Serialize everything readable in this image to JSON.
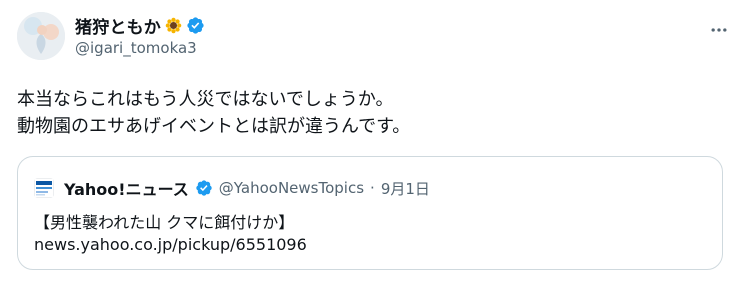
{
  "tweet": {
    "author": {
      "display_name": "猪狩ともか",
      "emoji": "sunflower",
      "verified_icon": "verified-badge-icon",
      "handle": "@igari_tomoka3"
    },
    "text_lines": [
      "本当ならこれはもう人災ではないでしょうか。",
      "動物園のエサあげイベントとは訳が違うんです。"
    ],
    "more_icon": "more-options-icon"
  },
  "quote": {
    "author": {
      "display_name": "Yahoo!ニュース",
      "handle": "@YahooNewsTopics",
      "separator": "·",
      "date": "9月1日",
      "verified_icon": "verified-badge-icon"
    },
    "lines": [
      "【男性襲われた山 クマに餌付けか】",
      "news.yahoo.co.jp/pickup/6551096"
    ]
  },
  "colors": {
    "text": "#0f1419",
    "secondary": "#536471",
    "verified": "#1d9bf0",
    "border": "#cfd9de"
  }
}
